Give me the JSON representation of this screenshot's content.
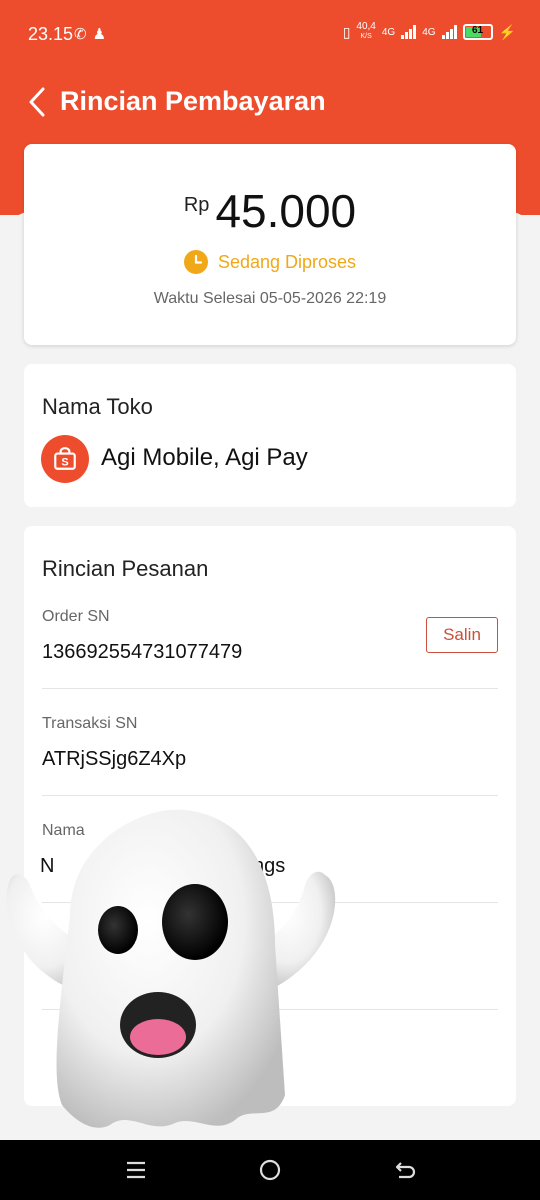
{
  "status_bar": {
    "time": "23.15",
    "net_speed_value": "40,4",
    "net_speed_unit": "K/S",
    "network_1": "4G",
    "network_2": "4G",
    "battery_level": "61"
  },
  "header": {
    "title": "Rincian Pembayaran"
  },
  "payment": {
    "currency": "Rp",
    "amount": "45.000",
    "status": "Sedang Diproses",
    "finish_label": "Waktu Selesai",
    "finish_time": "05-05-2026 22:19"
  },
  "shop": {
    "section_title": "Nama Toko",
    "name": "Agi Mobile, Agi Pay"
  },
  "order": {
    "section_title": "Rincian Pesanan",
    "order_sn_label": "Order SN",
    "order_sn_value": "136692554731077479",
    "copy_label": "Salin",
    "transaction_sn_label": "Transaksi SN",
    "transaction_sn_value": "ATRjSSjg6Z4Xp",
    "name_label_partial": "Nama",
    "name_value_start": "N",
    "name_value_end": "ngs"
  },
  "colors": {
    "brand": "#ee4d2d",
    "status_pending": "#f0a818",
    "copy_border": "#c9503a"
  },
  "icons": [
    "whatsapp-icon",
    "add-user-icon",
    "vibrate-icon",
    "signal-icon",
    "battery-icon",
    "charging-icon",
    "back-chevron-icon",
    "clock-icon",
    "shop-bag-icon",
    "ghost-sticker",
    "menu-icon",
    "home-icon",
    "back-nav-icon"
  ]
}
